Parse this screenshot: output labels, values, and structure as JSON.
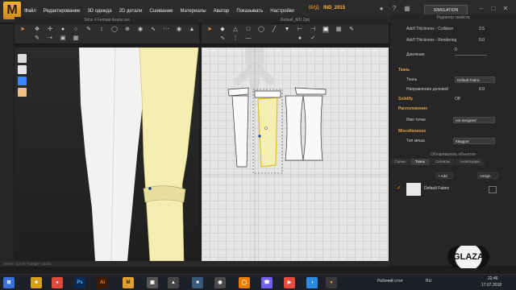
{
  "app": {
    "menu": [
      "Файл",
      "Редактирование",
      "3D одежда",
      "2D детали",
      "Сшивание",
      "Материалы",
      "Аватар",
      "Показывать",
      "Настройки"
    ],
    "project_label": "ВИД",
    "project_name": "IND_2015",
    "simulation_label": "SIMULATION"
  },
  "panels": {
    "view3d_title": "Sims 4 Female Avatar.avt",
    "view2d_title": "Default_MD.Zprj",
    "properties_title": "Редактор свойств",
    "browser_title": "Обозреватель объектов"
  },
  "properties": {
    "rows": [
      {
        "key": "Add'l Thickness - Collision",
        "value": "2.5"
      },
      {
        "key": "Add'l Thickness - Rendering",
        "value": "0.0"
      },
      {
        "key": "Давление",
        "value": "0"
      }
    ],
    "fabric_section": "Ткань",
    "fabric_key": "Ткань",
    "fabric_value": "Default Fabric",
    "grain_key": "Направление долевой",
    "grain_value": "0.0",
    "solidify_key": "Solidify",
    "solidify_value": "Off",
    "arrangement_section": "Расположение",
    "point_key": "Имя точки",
    "point_value": "not assigned",
    "misc_section": "Miscellaneous",
    "mesh_key": "Тип меша",
    "mesh_value": "Квадрат"
  },
  "browser": {
    "tabs": [
      "Сцена",
      "Ткань",
      "Сигналы",
      "Аксессуары"
    ],
    "active_tab": "Ткань",
    "add_label": "+ Add",
    "assign_label": "Assign",
    "item_label": "Default Fabric"
  },
  "status": {
    "left": "Vertex: 11476  Triangle: 22441"
  },
  "taskbar": {
    "desktop_label": "Рабочий стол",
    "lang": "RU",
    "time": "22:46",
    "date": "17.07.2018",
    "watermark": "GLAZA"
  },
  "colors": {
    "accent": "#f0a030",
    "fabric_selected": "#f4eeb0",
    "fabric_unselected": "#f2f2f2"
  }
}
